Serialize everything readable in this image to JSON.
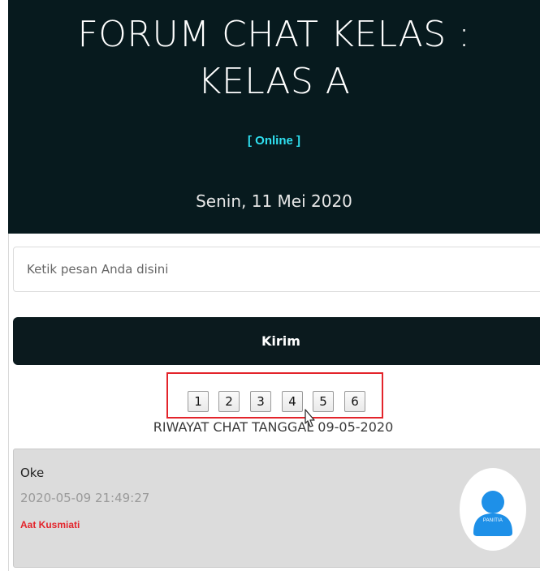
{
  "header": {
    "title_line1": "FORUM CHAT KELAS :",
    "title_line2": "KELAS A",
    "status": "[ Online ]",
    "date": "Senin, 11 Mei 2020"
  },
  "composer": {
    "placeholder": "Ketik pesan Anda disini",
    "send_label": "Kirim"
  },
  "pagination": {
    "pages": [
      "1",
      "2",
      "3",
      "4",
      "5",
      "6"
    ]
  },
  "history": {
    "title": "RIWAYAT CHAT TANGGAL 09-05-2020"
  },
  "messages": [
    {
      "text": "Oke",
      "timestamp": "2020-05-09 21:49:27",
      "author": "Aat Kusmiati",
      "avatar_label": "PANITIA",
      "avatar_icon": "user-icon"
    }
  ],
  "colors": {
    "header_bg": "#071a1e",
    "status": "#2fe0f0",
    "author": "#e3242b",
    "highlight": "#e3242b",
    "avatar_blue": "#1e90e8"
  }
}
